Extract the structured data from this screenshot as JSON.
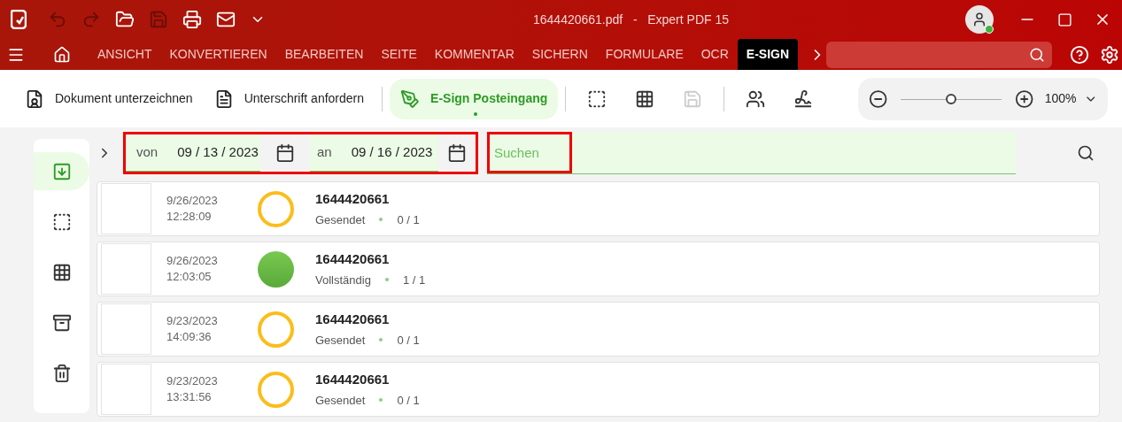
{
  "window": {
    "title": "1644420661.pdf   -   Expert PDF 15"
  },
  "quick_toolbar": [
    {
      "kind": "undo",
      "disabled": true
    },
    {
      "kind": "redo",
      "disabled": true
    },
    {
      "kind": "open",
      "disabled": false
    },
    {
      "kind": "save",
      "disabled": true
    },
    {
      "kind": "print",
      "disabled": false
    },
    {
      "kind": "mail",
      "disabled": false
    },
    {
      "kind": "more",
      "disabled": false
    }
  ],
  "menu_tabs": [
    {
      "label": "ANSICHT",
      "selected": false
    },
    {
      "label": "KONVERTIEREN",
      "selected": false
    },
    {
      "label": "BEARBEITEN",
      "selected": false
    },
    {
      "label": "SEITE",
      "selected": false
    },
    {
      "label": "KOMMENTAR",
      "selected": false
    },
    {
      "label": "SICHERN",
      "selected": false
    },
    {
      "label": "FORMULARE",
      "selected": false
    },
    {
      "label": "OCR",
      "selected": false
    },
    {
      "label": "E-SIGN",
      "selected": true
    }
  ],
  "ribbon": [
    {
      "kind": "sign",
      "label": "Dokument unterzeichnen",
      "selected": false
    },
    {
      "kind": "request",
      "label": "Unterschrift anfordern",
      "selected": false
    },
    {
      "kind": "inbox",
      "label": "E-Sign Posteingang",
      "selected": true
    }
  ],
  "ribbon_icons": [
    {
      "kind": "select",
      "disabled": false
    },
    {
      "kind": "grid",
      "disabled": false
    },
    {
      "kind": "save",
      "disabled": true
    },
    {
      "kind": "people",
      "disabled": false
    },
    {
      "kind": "signature",
      "disabled": false
    }
  ],
  "zoom": {
    "level": 0.5,
    "value": "100%"
  },
  "sidebar": [
    {
      "kind": "inbox",
      "selected": true
    },
    {
      "kind": "select",
      "selected": false
    },
    {
      "kind": "grid",
      "selected": false
    },
    {
      "kind": "archive",
      "selected": false
    },
    {
      "kind": "trash",
      "selected": false
    }
  ],
  "filter": {
    "highlighted": true,
    "from_label": "von",
    "from_value": "09 / 13 / 2023",
    "to_label": "an",
    "to_value": "09 / 16 / 2023"
  },
  "search": {
    "placeholder": "Suchen",
    "highlighted": true
  },
  "documents": [
    {
      "date": "9/26/2023",
      "time": "12:28:09",
      "complete": false,
      "name": "1644420661",
      "state": "Gesendet",
      "count": "0 / 1"
    },
    {
      "date": "9/26/2023",
      "time": "12:03:05",
      "complete": true,
      "name": "1644420661",
      "state": "Vollständig",
      "count": "1 / 1"
    },
    {
      "date": "9/23/2023",
      "time": "14:09:36",
      "complete": false,
      "name": "1644420661",
      "state": "Gesendet",
      "count": "0 / 1"
    },
    {
      "date": "9/23/2023",
      "time": "13:31:56",
      "complete": false,
      "name": "1644420661",
      "state": "Gesendet",
      "count": "0 / 1"
    }
  ]
}
